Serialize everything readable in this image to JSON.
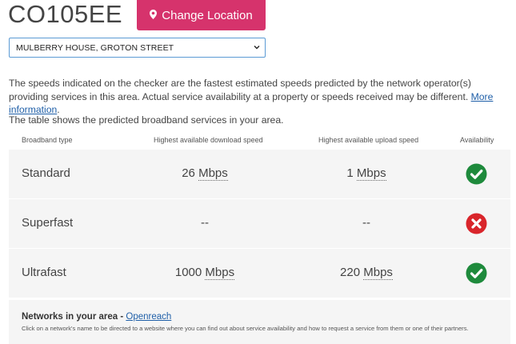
{
  "postcode": "CO105EE",
  "change_location_label": "Change Location",
  "address_selected": "MULBERRY HOUSE, GROTON STREET",
  "intro": {
    "text": "The speeds indicated on the checker are the fastest estimated speeds predicted by the network operator(s) providing services in this area. Actual service availability at a property or speeds received may be different.",
    "link_label": "More information",
    "after_link": "."
  },
  "table_intro": "The table shows the predicted broadband services in your area.",
  "table": {
    "headers": {
      "type": "Broadband type",
      "download": "Highest available download speed",
      "upload": "Highest available upload speed",
      "availability": "Availability"
    },
    "rows": [
      {
        "type": "Standard",
        "download_value": "26",
        "download_unit": "Mbps",
        "upload_value": "1",
        "upload_unit": "Mbps",
        "available": true
      },
      {
        "type": "Superfast",
        "download_value": "--",
        "download_unit": "",
        "upload_value": "--",
        "upload_unit": "",
        "available": false
      },
      {
        "type": "Ultrafast",
        "download_value": "1000",
        "download_unit": "Mbps",
        "upload_value": "220",
        "upload_unit": "Mbps",
        "available": true
      }
    ]
  },
  "networks": {
    "title": "Networks in your area - ",
    "link_label": "Openreach",
    "note": "Click on a network's name to be directed to a website where you can find out about service availability and how to request a service from them or one of their partners."
  },
  "colors": {
    "button": "#d6336c",
    "available": "#1e8a3c",
    "unavailable": "#d9252b",
    "link": "#1f5fa8"
  },
  "icons": {
    "button": "map-marker-icon",
    "available": "check-circle-icon",
    "unavailable": "cross-circle-icon",
    "select": "chevron-down-icon"
  }
}
